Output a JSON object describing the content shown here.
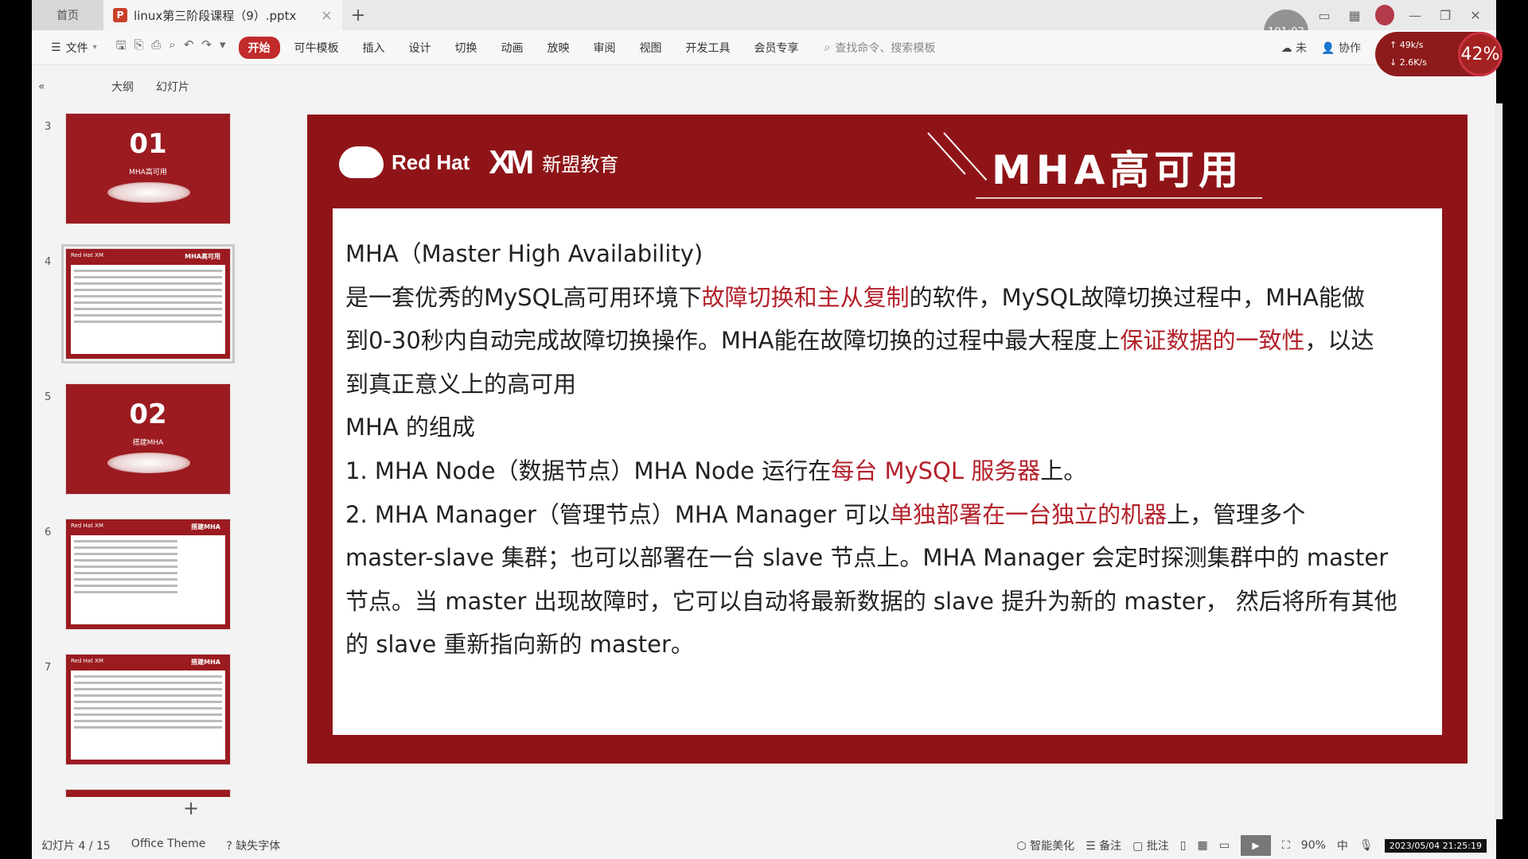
{
  "tabs": {
    "home": "首页",
    "doc_title": "linux第三阶段课程（9）.pptx",
    "close": "×",
    "add": "+"
  },
  "timer": "101:03",
  "ribbon": {
    "file": "文件",
    "tabs": [
      "开始",
      "可牛模板",
      "插入",
      "设计",
      "切换",
      "动画",
      "放映",
      "审阅",
      "视图",
      "开发工具",
      "会员专享"
    ],
    "active_tab": "开始",
    "search_placeholder": "查找命令、搜索模板",
    "right": {
      "cloud": "未",
      "collab": "协作"
    }
  },
  "netspeed": {
    "up": "49k/s",
    "down": "2.6K/s",
    "percent": "42%"
  },
  "viewbar": {
    "collapse": "«",
    "outline": "大纲",
    "slides": "幻灯片"
  },
  "thumbnails": [
    {
      "num": "3",
      "big": "01",
      "caption": "MHA高可用"
    },
    {
      "num": "4",
      "title": "MHA高可用"
    },
    {
      "num": "5",
      "big": "02",
      "caption": "搭建MHA"
    },
    {
      "num": "6",
      "title": "搭建MHA"
    },
    {
      "num": "7",
      "title": "搭建MHA"
    }
  ],
  "add_slide": "+",
  "slide": {
    "brand_redhat": "Red Hat",
    "brand_mark": "XM",
    "brand_name": "新盟教育",
    "title": "MHA高可用",
    "lines": {
      "l1": "MHA（Master High Availability)",
      "l2a": "是一套优秀的MySQL高可用环境下",
      "l2b": "故障切换和主从复制",
      "l2c": "的软件，MySQL故障切换过程中，MHA能做",
      "l3a": "到0-30秒内自动完成故障切换操作。MHA能在故障切换的过程中最大程度上",
      "l3b": "保证数据的一致性",
      "l3c": "，以达",
      "l4": "到真正意义上的高可用",
      "l5": "MHA 的组成",
      "l6a": "1. MHA Node（数据节点）MHA Node 运行在",
      "l6b": "每台 MySQL 服务器",
      "l6c": "上。",
      "l7a": "2. MHA Manager（管理节点）MHA Manager 可以",
      "l7b": "单独部署在一台独立的机器",
      "l7c": "上，管理多个",
      "l8": "master-slave 集群；也可以部署在一台 slave 节点上。MHA Manager 会定时探测集群中的 master",
      "l9": "节点。当 master 出现故障时，它可以自动将最新数据的 slave 提升为新的 master， 然后将所有其他",
      "l10": "的 slave 重新指向新的 master。"
    }
  },
  "status": {
    "slide_pos": "幻灯片 4 / 15",
    "theme": "Office Theme",
    "missing_font": "缺失字体",
    "beautify": "智能美化",
    "notes": "备注",
    "comments": "批注",
    "zoom": "90%",
    "ime": "中",
    "datetime": "2023/05/04 21:25:19"
  },
  "colors": {
    "accent": "#c22b2b",
    "slide_bg": "#8f1418",
    "highlight": "#b3202a"
  }
}
